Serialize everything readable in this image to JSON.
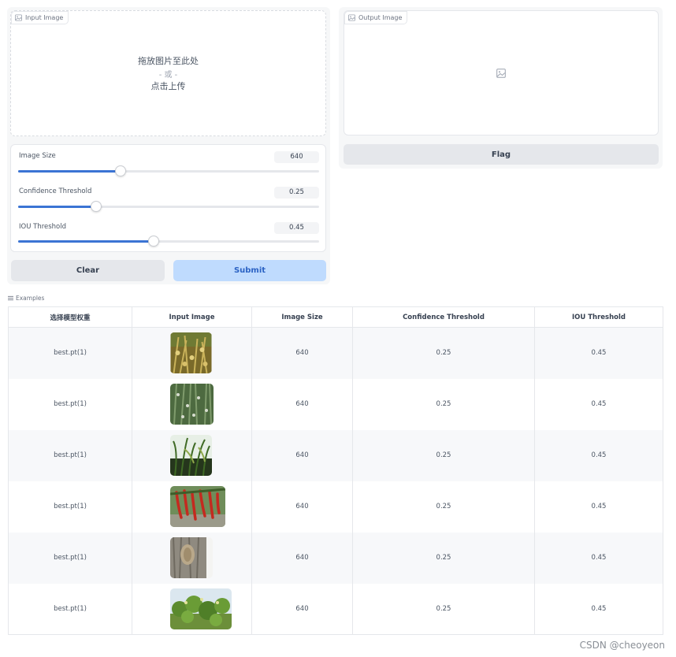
{
  "input_panel": {
    "label": "Input Image",
    "drop_text": "拖放图片至此处",
    "or_text": "- 或 -",
    "click_text": "点击上传"
  },
  "output_panel": {
    "label": "Output Image"
  },
  "sliders": [
    {
      "label": "Image Size",
      "value": "640",
      "fraction": 0.34
    },
    {
      "label": "Confidence Threshold",
      "value": "0.25",
      "fraction": 0.26
    },
    {
      "label": "IOU Threshold",
      "value": "0.45",
      "fraction": 0.45
    }
  ],
  "buttons": {
    "clear": "Clear",
    "submit": "Submit",
    "flag": "Flag"
  },
  "examples": {
    "label": "Examples",
    "columns": [
      "选择模型权重",
      "Input Image",
      "Image Size",
      "Confidence Threshold",
      "IOU Threshold"
    ],
    "rows": [
      {
        "weights": "best.pt(1)",
        "image_icon": "wheat-field-thumbnail",
        "size": "640",
        "conf": "0.25",
        "iou": "0.45"
      },
      {
        "weights": "best.pt(1)",
        "image_icon": "green-crop-thumbnail",
        "size": "640",
        "conf": "0.25",
        "iou": "0.45"
      },
      {
        "weights": "best.pt(1)",
        "image_icon": "rice-plant-thumbnail",
        "size": "640",
        "conf": "0.25",
        "iou": "0.45"
      },
      {
        "weights": "best.pt(1)",
        "image_icon": "red-chili-thumbnail",
        "size": "640",
        "conf": "0.25",
        "iou": "0.45"
      },
      {
        "weights": "best.pt(1)",
        "image_icon": "tree-bark-thumbnail",
        "size": "640",
        "conf": "0.25",
        "iou": "0.45"
      },
      {
        "weights": "best.pt(1)",
        "image_icon": "leafy-plant-thumbnail",
        "size": "640",
        "conf": "0.25",
        "iou": "0.45"
      }
    ]
  },
  "watermark": "CSDN @cheoyeon",
  "colors": {
    "accent": "#3b74d4",
    "primary_button_bg": "#bfdbfe",
    "primary_button_text": "#2c63c4",
    "secondary_button_bg": "#e5e7eb"
  }
}
